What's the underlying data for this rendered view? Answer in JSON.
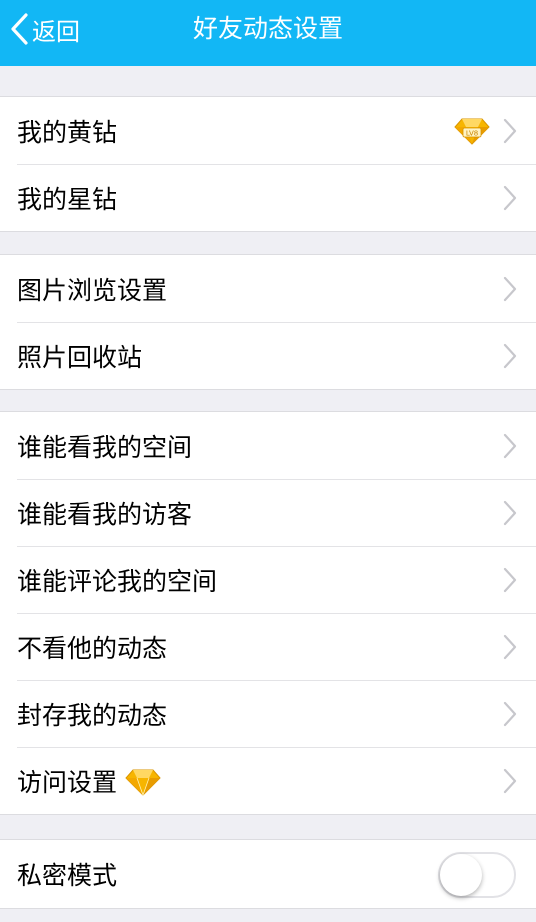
{
  "nav": {
    "back_label": "返回",
    "title": "好友动态设置",
    "bar_color": "#12b7f5"
  },
  "groups": [
    {
      "items": [
        {
          "label": "我的黄钻",
          "badge": "yellow-diamond-lv-icon"
        },
        {
          "label": "我的星钻"
        }
      ]
    },
    {
      "items": [
        {
          "label": "图片浏览设置"
        },
        {
          "label": "照片回收站"
        }
      ]
    },
    {
      "items": [
        {
          "label": "谁能看我的空间"
        },
        {
          "label": "谁能看我的访客"
        },
        {
          "label": "谁能评论我的空间"
        },
        {
          "label": "不看他的动态"
        },
        {
          "label": "封存我的动态"
        },
        {
          "label": "访问设置",
          "badge": "yellow-diamond-icon"
        }
      ]
    },
    {
      "items": [
        {
          "label": "私密模式",
          "toggle": false
        }
      ]
    }
  ],
  "icons": {
    "chevron": "chevron-right-icon",
    "back": "chevron-left-icon"
  },
  "colors": {
    "background": "#efeff4",
    "chevron": "#c7c7cc",
    "diamond": "#f7b500"
  }
}
